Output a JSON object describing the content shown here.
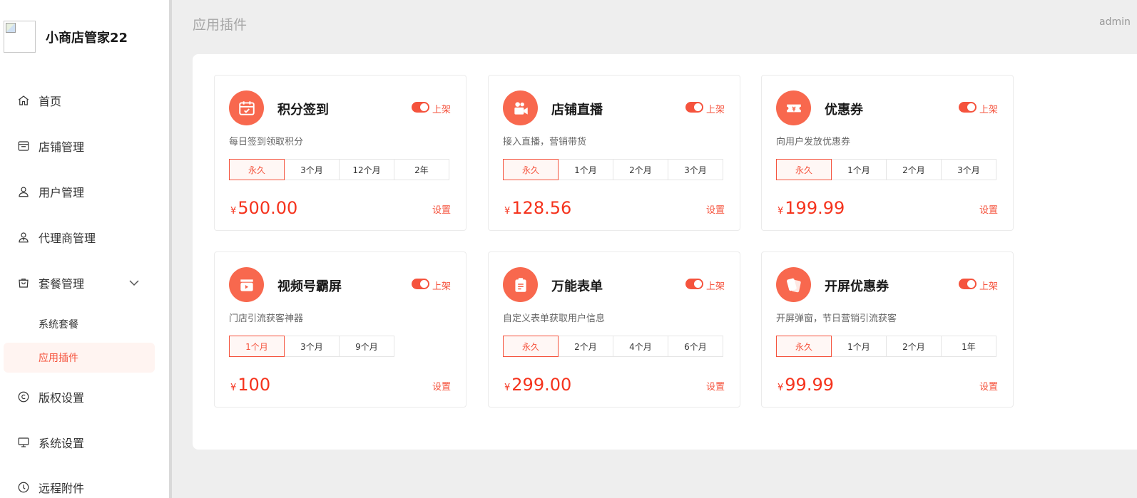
{
  "app": {
    "name": "小商店管家22"
  },
  "header": {
    "title": "应用插件",
    "user": "admin"
  },
  "sidebar": {
    "items": [
      {
        "label": "首页",
        "icon": "home-icon"
      },
      {
        "label": "店铺管理",
        "icon": "store-icon"
      },
      {
        "label": "用户管理",
        "icon": "user-icon"
      },
      {
        "label": "代理商管理",
        "icon": "agent-icon"
      },
      {
        "label": "套餐管理",
        "icon": "bag-icon"
      },
      {
        "label": "版权设置",
        "icon": "copyright-icon"
      },
      {
        "label": "系统设置",
        "icon": "monitor-icon"
      },
      {
        "label": "远程附件",
        "icon": "cloud-icon"
      }
    ],
    "sub_items": [
      {
        "label": "系统套餐",
        "active": false
      },
      {
        "label": "应用插件",
        "active": true
      }
    ]
  },
  "plugins": [
    {
      "name": "积分签到",
      "icon": "calendar-check-icon",
      "status": "上架",
      "desc": "每日签到领取积分",
      "options": [
        "永久",
        "3个月",
        "12个月",
        "2年"
      ],
      "selected": 0,
      "currency": "¥",
      "price": "500.00",
      "action": "设置"
    },
    {
      "name": "店铺直播",
      "icon": "video-camera-icon",
      "status": "上架",
      "desc": "接入直播，营销带货",
      "options": [
        "永久",
        "1个月",
        "2个月",
        "3个月"
      ],
      "selected": 0,
      "currency": "¥",
      "price": "128.56",
      "action": "设置"
    },
    {
      "name": "优惠券",
      "icon": "coupon-icon",
      "status": "上架",
      "desc": "向用户发放优惠券",
      "options": [
        "永久",
        "1个月",
        "2个月",
        "3个月"
      ],
      "selected": 0,
      "currency": "¥",
      "price": "199.99",
      "action": "设置"
    },
    {
      "name": "视频号霸屏",
      "icon": "clapper-icon",
      "status": "上架",
      "desc": "门店引流获客神器",
      "options": [
        "1个月",
        "3个月",
        "9个月"
      ],
      "selected": 0,
      "currency": "¥",
      "price": "100",
      "action": "设置"
    },
    {
      "name": "万能表单",
      "icon": "clipboard-icon",
      "status": "上架",
      "desc": "自定义表单获取用户信息",
      "options": [
        "永久",
        "2个月",
        "4个月",
        "6个月"
      ],
      "selected": 0,
      "currency": "¥",
      "price": "299.00",
      "action": "设置"
    },
    {
      "name": "开屏优惠券",
      "icon": "tickets-icon",
      "status": "上架",
      "desc": "开屏弹窗，节日营销引流获客",
      "options": [
        "永久",
        "1个月",
        "2个月",
        "1年"
      ],
      "selected": 0,
      "currency": "¥",
      "price": "99.99",
      "action": "设置"
    }
  ],
  "colors": {
    "accent": "#f5533d",
    "price": "#f5331d",
    "badge": "#f8684e"
  }
}
